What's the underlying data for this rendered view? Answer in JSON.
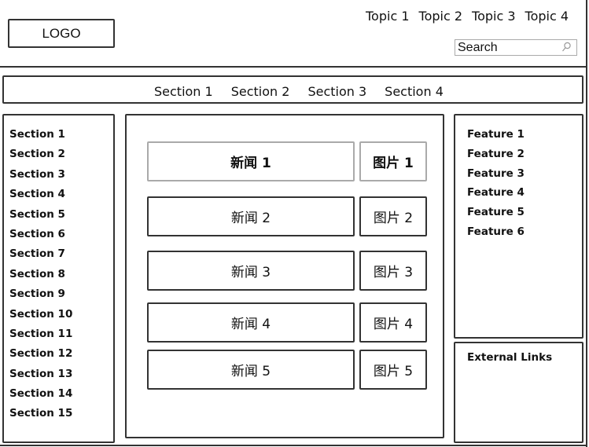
{
  "header": {
    "logo": "LOGO",
    "topics": [
      "Topic 1",
      "Topic 2",
      "Topic 3",
      "Topic 4"
    ],
    "search": {
      "placeholder": "Search",
      "value": "",
      "icon": "search-icon"
    }
  },
  "section_nav": {
    "items": [
      "Section 1",
      "Section 2",
      "Section 3",
      "Section 4"
    ]
  },
  "left_sidebar": {
    "items": [
      "Section 1",
      "Section 2",
      "Section 3",
      "Section 4",
      "Section 5",
      "Section 6",
      "Section 7",
      "Section 8",
      "Section 9",
      "Section 10",
      "Section 11",
      "Section 12",
      "Section 13",
      "Section 14",
      "Section 15"
    ]
  },
  "main": {
    "rows": [
      {
        "news": "新闻 1",
        "picture": "图片 1"
      },
      {
        "news": "新闻 2",
        "picture": "图片 2"
      },
      {
        "news": "新闻 3",
        "picture": "图片 3"
      },
      {
        "news": "新闻 4",
        "picture": "图片 4"
      },
      {
        "news": "新闻 5",
        "picture": "图片 5"
      }
    ]
  },
  "right_sidebar": {
    "features": [
      "Feature 1",
      "Feature 2",
      "Feature 3",
      "Feature 4",
      "Feature 5",
      "Feature 6"
    ],
    "external_links_title": "External Links"
  }
}
